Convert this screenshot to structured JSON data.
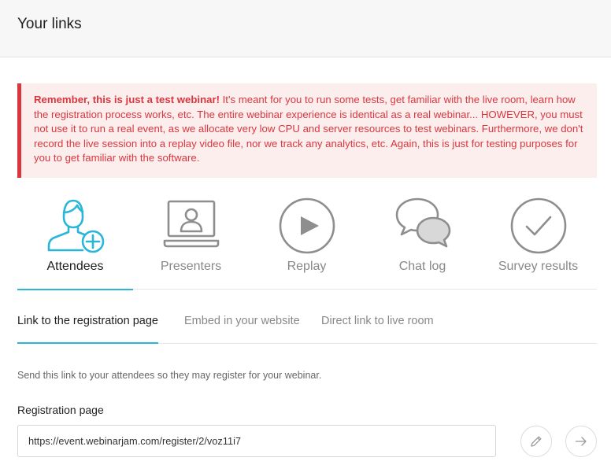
{
  "header": {
    "title": "Your links"
  },
  "alert": {
    "bold": "Remember, this is just a test webinar!",
    "text": " It's meant for you to run some tests, get familiar with the live room, learn how the registration process works, etc. The entire webinar experience is identical as a real webinar... HOWEVER, you must not use it to run a real event, as we allocate very low CPU and server resources to test webinars. Furthermore, we don't record the live session into a replay video file, nor we track any analytics, etc. Again, this is just for testing purposes for you to get familiar with the software."
  },
  "main_tabs": [
    {
      "label": "Attendees",
      "icon": "attendee-add-icon",
      "active": true
    },
    {
      "label": "Presenters",
      "icon": "presenter-laptop-icon",
      "active": false
    },
    {
      "label": "Replay",
      "icon": "play-circle-icon",
      "active": false
    },
    {
      "label": "Chat log",
      "icon": "chat-bubbles-icon",
      "active": false
    },
    {
      "label": "Survey results",
      "icon": "checkmark-circle-icon",
      "active": false
    }
  ],
  "sub_tabs": [
    {
      "label": "Link to the registration page",
      "active": true
    },
    {
      "label": "Embed in your website",
      "active": false
    },
    {
      "label": "Direct link to live room",
      "active": false
    }
  ],
  "registration": {
    "hint": "Send this link to your attendees so they may register for your webinar.",
    "label": "Registration page",
    "url": "https://event.webinarjam.com/register/2/voz11i7"
  },
  "actions": {
    "edit_icon": "pencil-icon",
    "open_icon": "arrow-right-icon"
  },
  "colors": {
    "accent": "#29b6d8",
    "alert_text": "#d9363e",
    "alert_bg": "#fdeeee",
    "icon_gray": "#8e8e8e"
  }
}
